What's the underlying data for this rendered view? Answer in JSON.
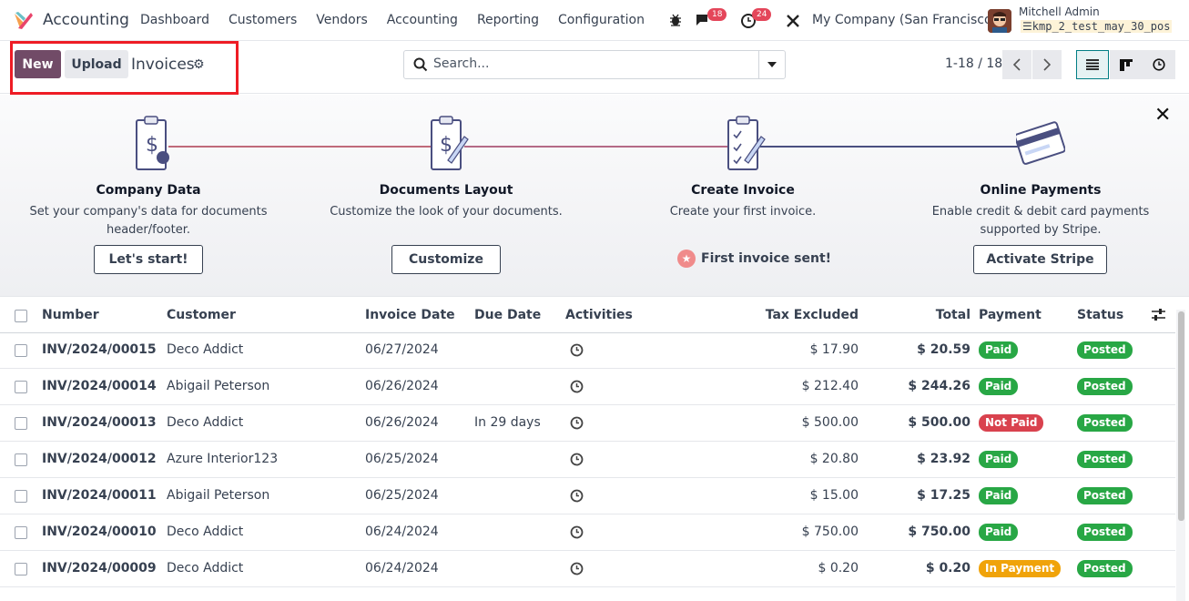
{
  "app": {
    "name": "Accounting"
  },
  "nav": [
    "Dashboard",
    "Customers",
    "Vendors",
    "Accounting",
    "Reporting",
    "Configuration"
  ],
  "systray": {
    "messages_count": "18",
    "activities_count": "24",
    "company": "My Company (San Francisco)",
    "user": "Mitchell Admin",
    "database": "kmp_2_test_may_30_pos"
  },
  "control": {
    "new_label": "New",
    "upload_label": "Upload",
    "breadcrumb": "Invoices",
    "search_placeholder": "Search...",
    "pager": "1-18 / 18"
  },
  "onboarding": {
    "steps": [
      {
        "title": "Company Data",
        "desc": "Set your company's data for documents header/footer.",
        "button": "Let's start!"
      },
      {
        "title": "Documents Layout",
        "desc": "Customize the look of your documents.",
        "button": "Customize"
      },
      {
        "title": "Create Invoice",
        "desc": "Create your first invoice.",
        "done": "First invoice sent!"
      },
      {
        "title": "Online Payments",
        "desc": "Enable credit & debit card payments supported by Stripe.",
        "button": "Activate Stripe"
      }
    ]
  },
  "table": {
    "columns": {
      "number": "Number",
      "customer": "Customer",
      "invoice_date": "Invoice Date",
      "due_date": "Due Date",
      "activities": "Activities",
      "tax_excluded": "Tax Excluded",
      "total": "Total",
      "payment": "Payment",
      "status": "Status"
    },
    "rows": [
      {
        "number": "INV/2024/00015",
        "customer": "Deco Addict",
        "invoice_date": "06/27/2024",
        "due_date": "",
        "tax_excluded": "$ 17.90",
        "total": "$ 20.59",
        "payment": "Paid",
        "status": "Posted"
      },
      {
        "number": "INV/2024/00014",
        "customer": "Abigail Peterson",
        "invoice_date": "06/26/2024",
        "due_date": "",
        "tax_excluded": "$ 212.40",
        "total": "$ 244.26",
        "payment": "Paid",
        "status": "Posted"
      },
      {
        "number": "INV/2024/00013",
        "customer": "Deco Addict",
        "invoice_date": "06/26/2024",
        "due_date": "In 29 days",
        "tax_excluded": "$ 500.00",
        "total": "$ 500.00",
        "payment": "Not Paid",
        "status": "Posted"
      },
      {
        "number": "INV/2024/00012",
        "customer": "Azure Interior123",
        "invoice_date": "06/25/2024",
        "due_date": "",
        "tax_excluded": "$ 20.80",
        "total": "$ 23.92",
        "payment": "Paid",
        "status": "Posted"
      },
      {
        "number": "INV/2024/00011",
        "customer": "Abigail Peterson",
        "invoice_date": "06/25/2024",
        "due_date": "",
        "tax_excluded": "$ 15.00",
        "total": "$ 17.25",
        "payment": "Paid",
        "status": "Posted"
      },
      {
        "number": "INV/2024/00010",
        "customer": "Deco Addict",
        "invoice_date": "06/24/2024",
        "due_date": "",
        "tax_excluded": "$ 750.00",
        "total": "$ 750.00",
        "payment": "Paid",
        "status": "Posted"
      },
      {
        "number": "INV/2024/00009",
        "customer": "Deco Addict",
        "invoice_date": "06/24/2024",
        "due_date": "",
        "tax_excluded": "$ 0.20",
        "total": "$ 0.20",
        "payment": "In Payment",
        "status": "Posted"
      }
    ]
  },
  "colors": {
    "brand": "#714b67",
    "paid": "#28a745",
    "not_paid": "#d9424e",
    "in_payment": "#f0a30a",
    "posted": "#28a745",
    "highlight": "#ee1c25"
  }
}
